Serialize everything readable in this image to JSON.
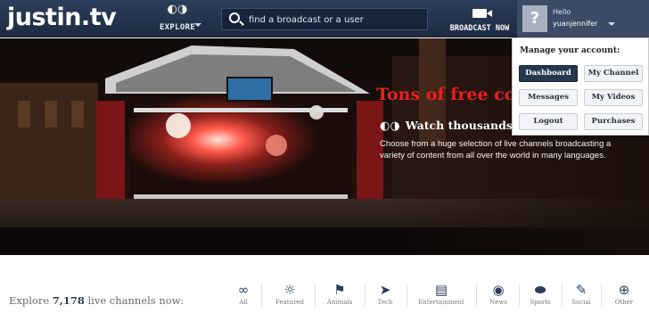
{
  "brand": {
    "logo_text": "justin.tv"
  },
  "nav": {
    "explore_label": "EXPLORE",
    "broadcast_label": "BROADCAST NOW"
  },
  "search": {
    "placeholder": "find a broadcast or a user",
    "value": ""
  },
  "user": {
    "greeting": "Hello",
    "username": "yuanjennifer",
    "avatar_glyph": "?"
  },
  "account_menu": {
    "heading": "Manage your account:",
    "items": [
      {
        "label": "Dashboard",
        "active": true
      },
      {
        "label": "My Channel",
        "active": false
      },
      {
        "label": "Messages",
        "active": false
      },
      {
        "label": "My Videos",
        "active": false
      },
      {
        "label": "Logout",
        "active": false
      },
      {
        "label": "Purchases",
        "active": false
      }
    ]
  },
  "hero": {
    "title": "Tons of free co",
    "subtitle": "Watch thousands of f",
    "description": "Choose from a huge selection of live channels broadcasting a variety of content from all over the world in many languages."
  },
  "explore_strip": {
    "prefix": "Explore ",
    "count": "7,178",
    "suffix": " live channels now:",
    "categories": [
      {
        "label": "All",
        "icon": "infinity-icon"
      },
      {
        "label": "Featured",
        "icon": "sun-icon"
      },
      {
        "label": "Animals",
        "icon": "rabbit-icon"
      },
      {
        "label": "Tech",
        "icon": "rocket-icon"
      },
      {
        "label": "Entertainment",
        "icon": "clapperboard-icon"
      },
      {
        "label": "News",
        "icon": "globe-icon"
      },
      {
        "label": "Sports",
        "icon": "football-icon"
      },
      {
        "label": "Social",
        "icon": "chat-icon"
      },
      {
        "label": "Other",
        "icon": "plus-circle-icon"
      }
    ]
  },
  "colors": {
    "topbar": "#22324c",
    "hero_title": "#e8211e",
    "active_button": "#27374f",
    "icon": "#2e3e59"
  }
}
